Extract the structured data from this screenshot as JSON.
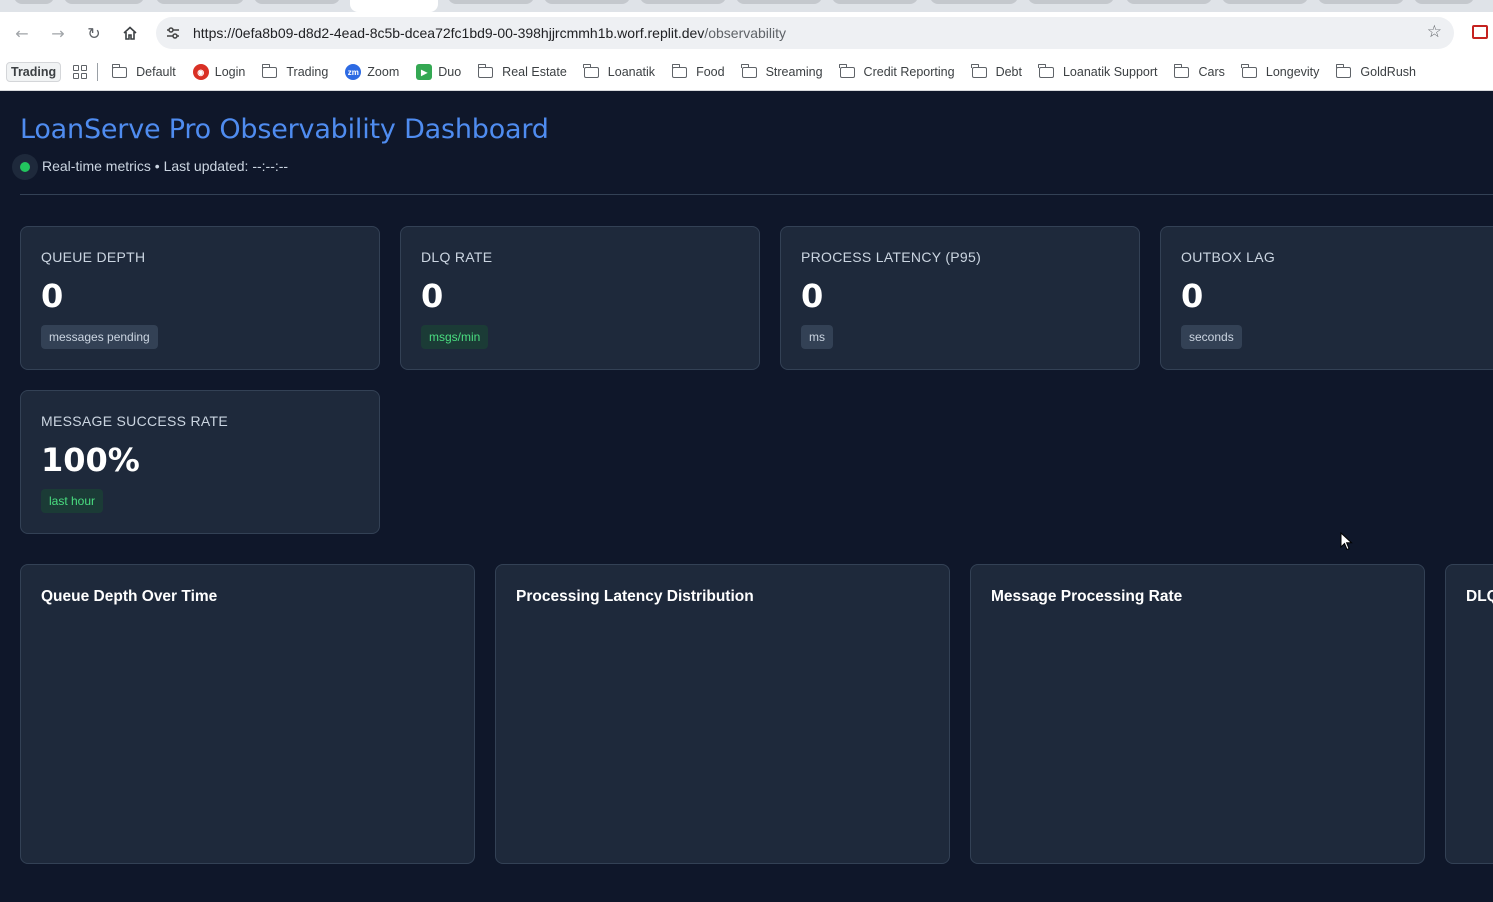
{
  "browser": {
    "url_host": "https://0efa8b09-d8d2-4ead-8c5b-dcea72fc1bd9-00-398hjjrcmmh1b.worf.replit.dev",
    "url_path": "/observability",
    "bookmarks_pill": "Trading",
    "bookmarks": [
      {
        "label": "Default",
        "icon": "folder-icon"
      },
      {
        "label": "Login",
        "icon": "login-favicon"
      },
      {
        "label": "Trading",
        "icon": "folder-icon"
      },
      {
        "label": "Zoom",
        "icon": "zoom-favicon"
      },
      {
        "label": "Duo",
        "icon": "duo-favicon"
      },
      {
        "label": "Real Estate",
        "icon": "folder-icon"
      },
      {
        "label": "Loanatik",
        "icon": "folder-icon"
      },
      {
        "label": "Food",
        "icon": "folder-icon"
      },
      {
        "label": "Streaming",
        "icon": "folder-icon"
      },
      {
        "label": "Credit Reporting",
        "icon": "folder-icon"
      },
      {
        "label": "Debt",
        "icon": "folder-icon"
      },
      {
        "label": "Loanatik Support",
        "icon": "folder-icon"
      },
      {
        "label": "Cars",
        "icon": "folder-icon"
      },
      {
        "label": "Longevity",
        "icon": "folder-icon"
      },
      {
        "label": "GoldRush",
        "icon": "folder-icon"
      }
    ]
  },
  "dashboard": {
    "title": "LoanServe Pro Observability Dashboard",
    "status": "Real-time metrics • Last updated: --:--:--",
    "status_color": "#22c55e",
    "metrics": [
      {
        "label": "QUEUE DEPTH",
        "value": "0",
        "unit": "messages pending"
      },
      {
        "label": "DLQ RATE",
        "value": "0",
        "unit": "msgs/min"
      },
      {
        "label": "PROCESS LATENCY (P95)",
        "value": "0",
        "unit": "ms"
      },
      {
        "label": "OUTBOX LAG",
        "value": "0",
        "unit": "seconds"
      },
      {
        "label": "MESSAGE SUCCESS RATE",
        "value": "100%",
        "unit": "last hour"
      }
    ],
    "charts": [
      {
        "title": "Queue Depth Over Time"
      },
      {
        "title": "Processing Latency Distribution"
      },
      {
        "title": "Message Processing Rate"
      },
      {
        "title": "DLQ"
      }
    ]
  }
}
